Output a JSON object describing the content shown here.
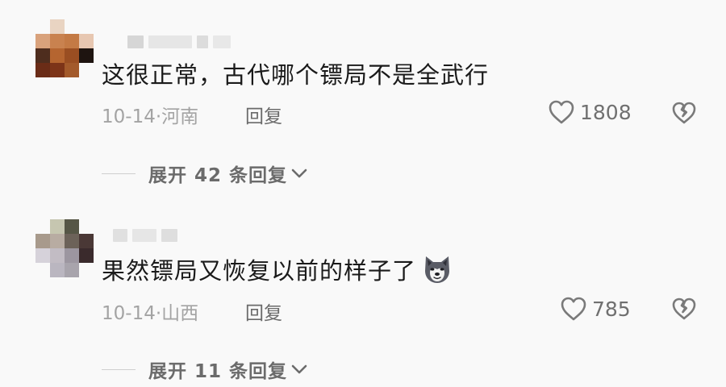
{
  "comments": [
    {
      "text": "这很正常，古代哪个镖局不是全武行",
      "date": "10-14",
      "location": "河南",
      "reply_label": "回复",
      "likes": "1808",
      "expand_label": "展开 42 条回复",
      "emoji": ""
    },
    {
      "text": "果然镖局又恢复以前的样子了",
      "date": "10-14",
      "location": "山西",
      "reply_label": "回复",
      "likes": "785",
      "expand_label": "展开 11 条回复",
      "emoji": "wolf-face-emoji"
    }
  ],
  "meta_separator": "·",
  "colors": {
    "background": "#f9f9f9",
    "text": "#1a1a1a",
    "meta": "#a3a3a3",
    "secondary": "#6b6b6b"
  },
  "icons": [
    "heart-icon",
    "broken-heart-icon",
    "chevron-down-icon"
  ]
}
